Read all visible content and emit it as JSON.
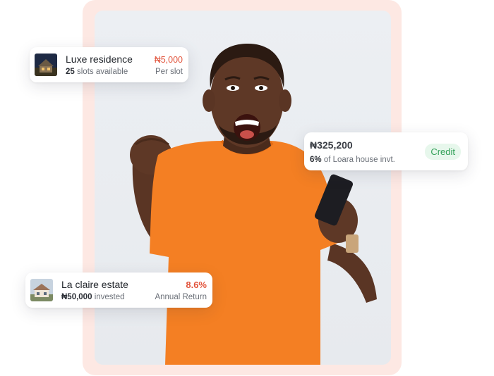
{
  "cards": {
    "luxe": {
      "title": "Luxe residence",
      "slots_count": "25",
      "slots_text": "slots available",
      "price": "₦5,000",
      "price_unit": "Per slot",
      "price_color": "#e2553d"
    },
    "credit": {
      "amount": "₦325,200",
      "percent": "6%",
      "description": "of Loara house invt.",
      "badge": "Credit",
      "badge_color": "#33a159"
    },
    "laclaire": {
      "title": "La claire estate",
      "invested_amount": "₦50,000",
      "invested_text": "invested",
      "return_rate": "8.6%",
      "return_label": "Annual Return",
      "rate_color": "#e2553d"
    }
  },
  "colors": {
    "frame": "#fde8e3",
    "shirt": "#f47f23"
  }
}
